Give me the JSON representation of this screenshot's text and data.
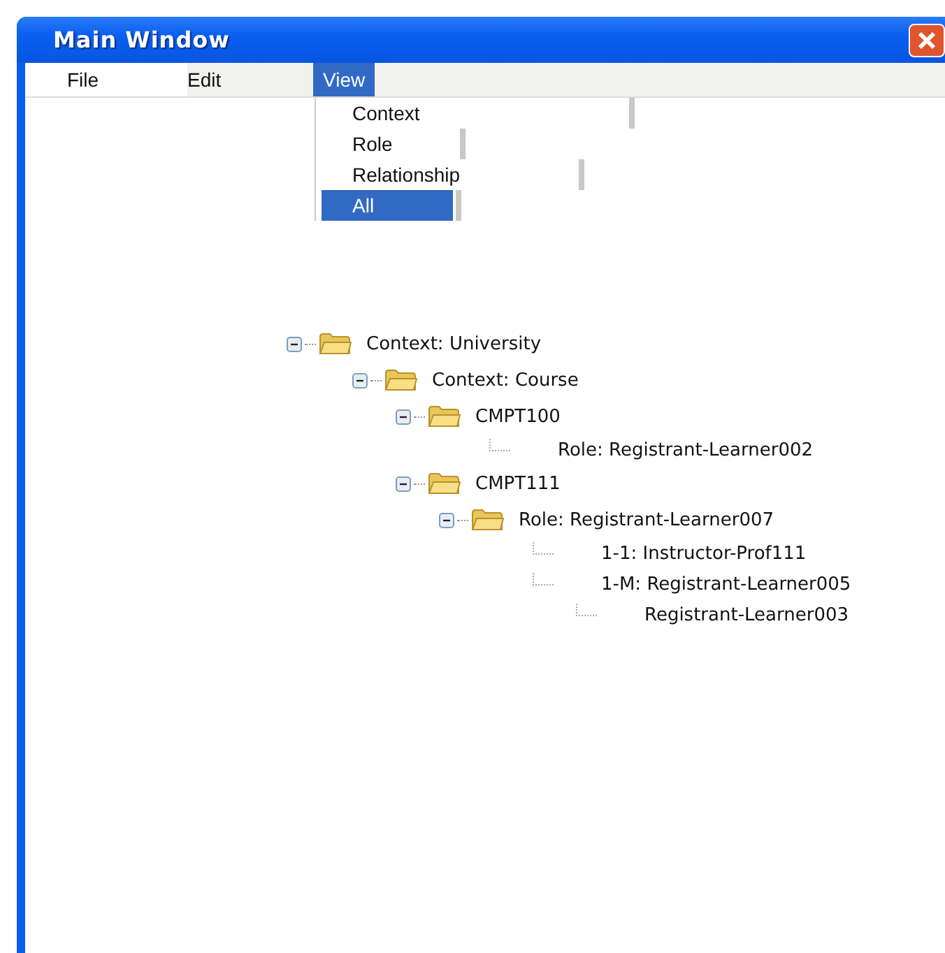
{
  "window": {
    "title": "Main Window"
  },
  "menu_bar": [
    {
      "label": "File",
      "selected": false
    },
    {
      "label": "Edit",
      "selected": false
    },
    {
      "label": "View",
      "selected": true
    }
  ],
  "view_menu": [
    {
      "label": "Context",
      "selected": false
    },
    {
      "label": "Role",
      "selected": false
    },
    {
      "label": "Relationship",
      "selected": false
    },
    {
      "label": "All",
      "selected": true
    }
  ],
  "tree": [
    {
      "label": "Context: University",
      "kind": "folder",
      "expanded": true,
      "children": [
        {
          "label": "Context: Course",
          "kind": "folder",
          "expanded": true,
          "children": [
            {
              "label": "CMPT100",
              "kind": "folder",
              "expanded": true,
              "children": [
                {
                  "label": "Role: Registrant-Learner002",
                  "kind": "leaf"
                }
              ]
            },
            {
              "label": "CMPT111",
              "kind": "folder",
              "expanded": true,
              "children": [
                {
                  "label": "Role: Registrant-Learner007",
                  "kind": "folder",
                  "expanded": true,
                  "children": [
                    {
                      "label": "1-1: Instructor-Prof111",
                      "kind": "leaf"
                    },
                    {
                      "label": "1-M: Registrant-Learner005",
                      "kind": "leaf",
                      "children": [
                        {
                          "label": "Registrant-Learner003",
                          "kind": "leaf"
                        }
                      ]
                    }
                  ]
                }
              ]
            }
          ]
        }
      ]
    }
  ]
}
